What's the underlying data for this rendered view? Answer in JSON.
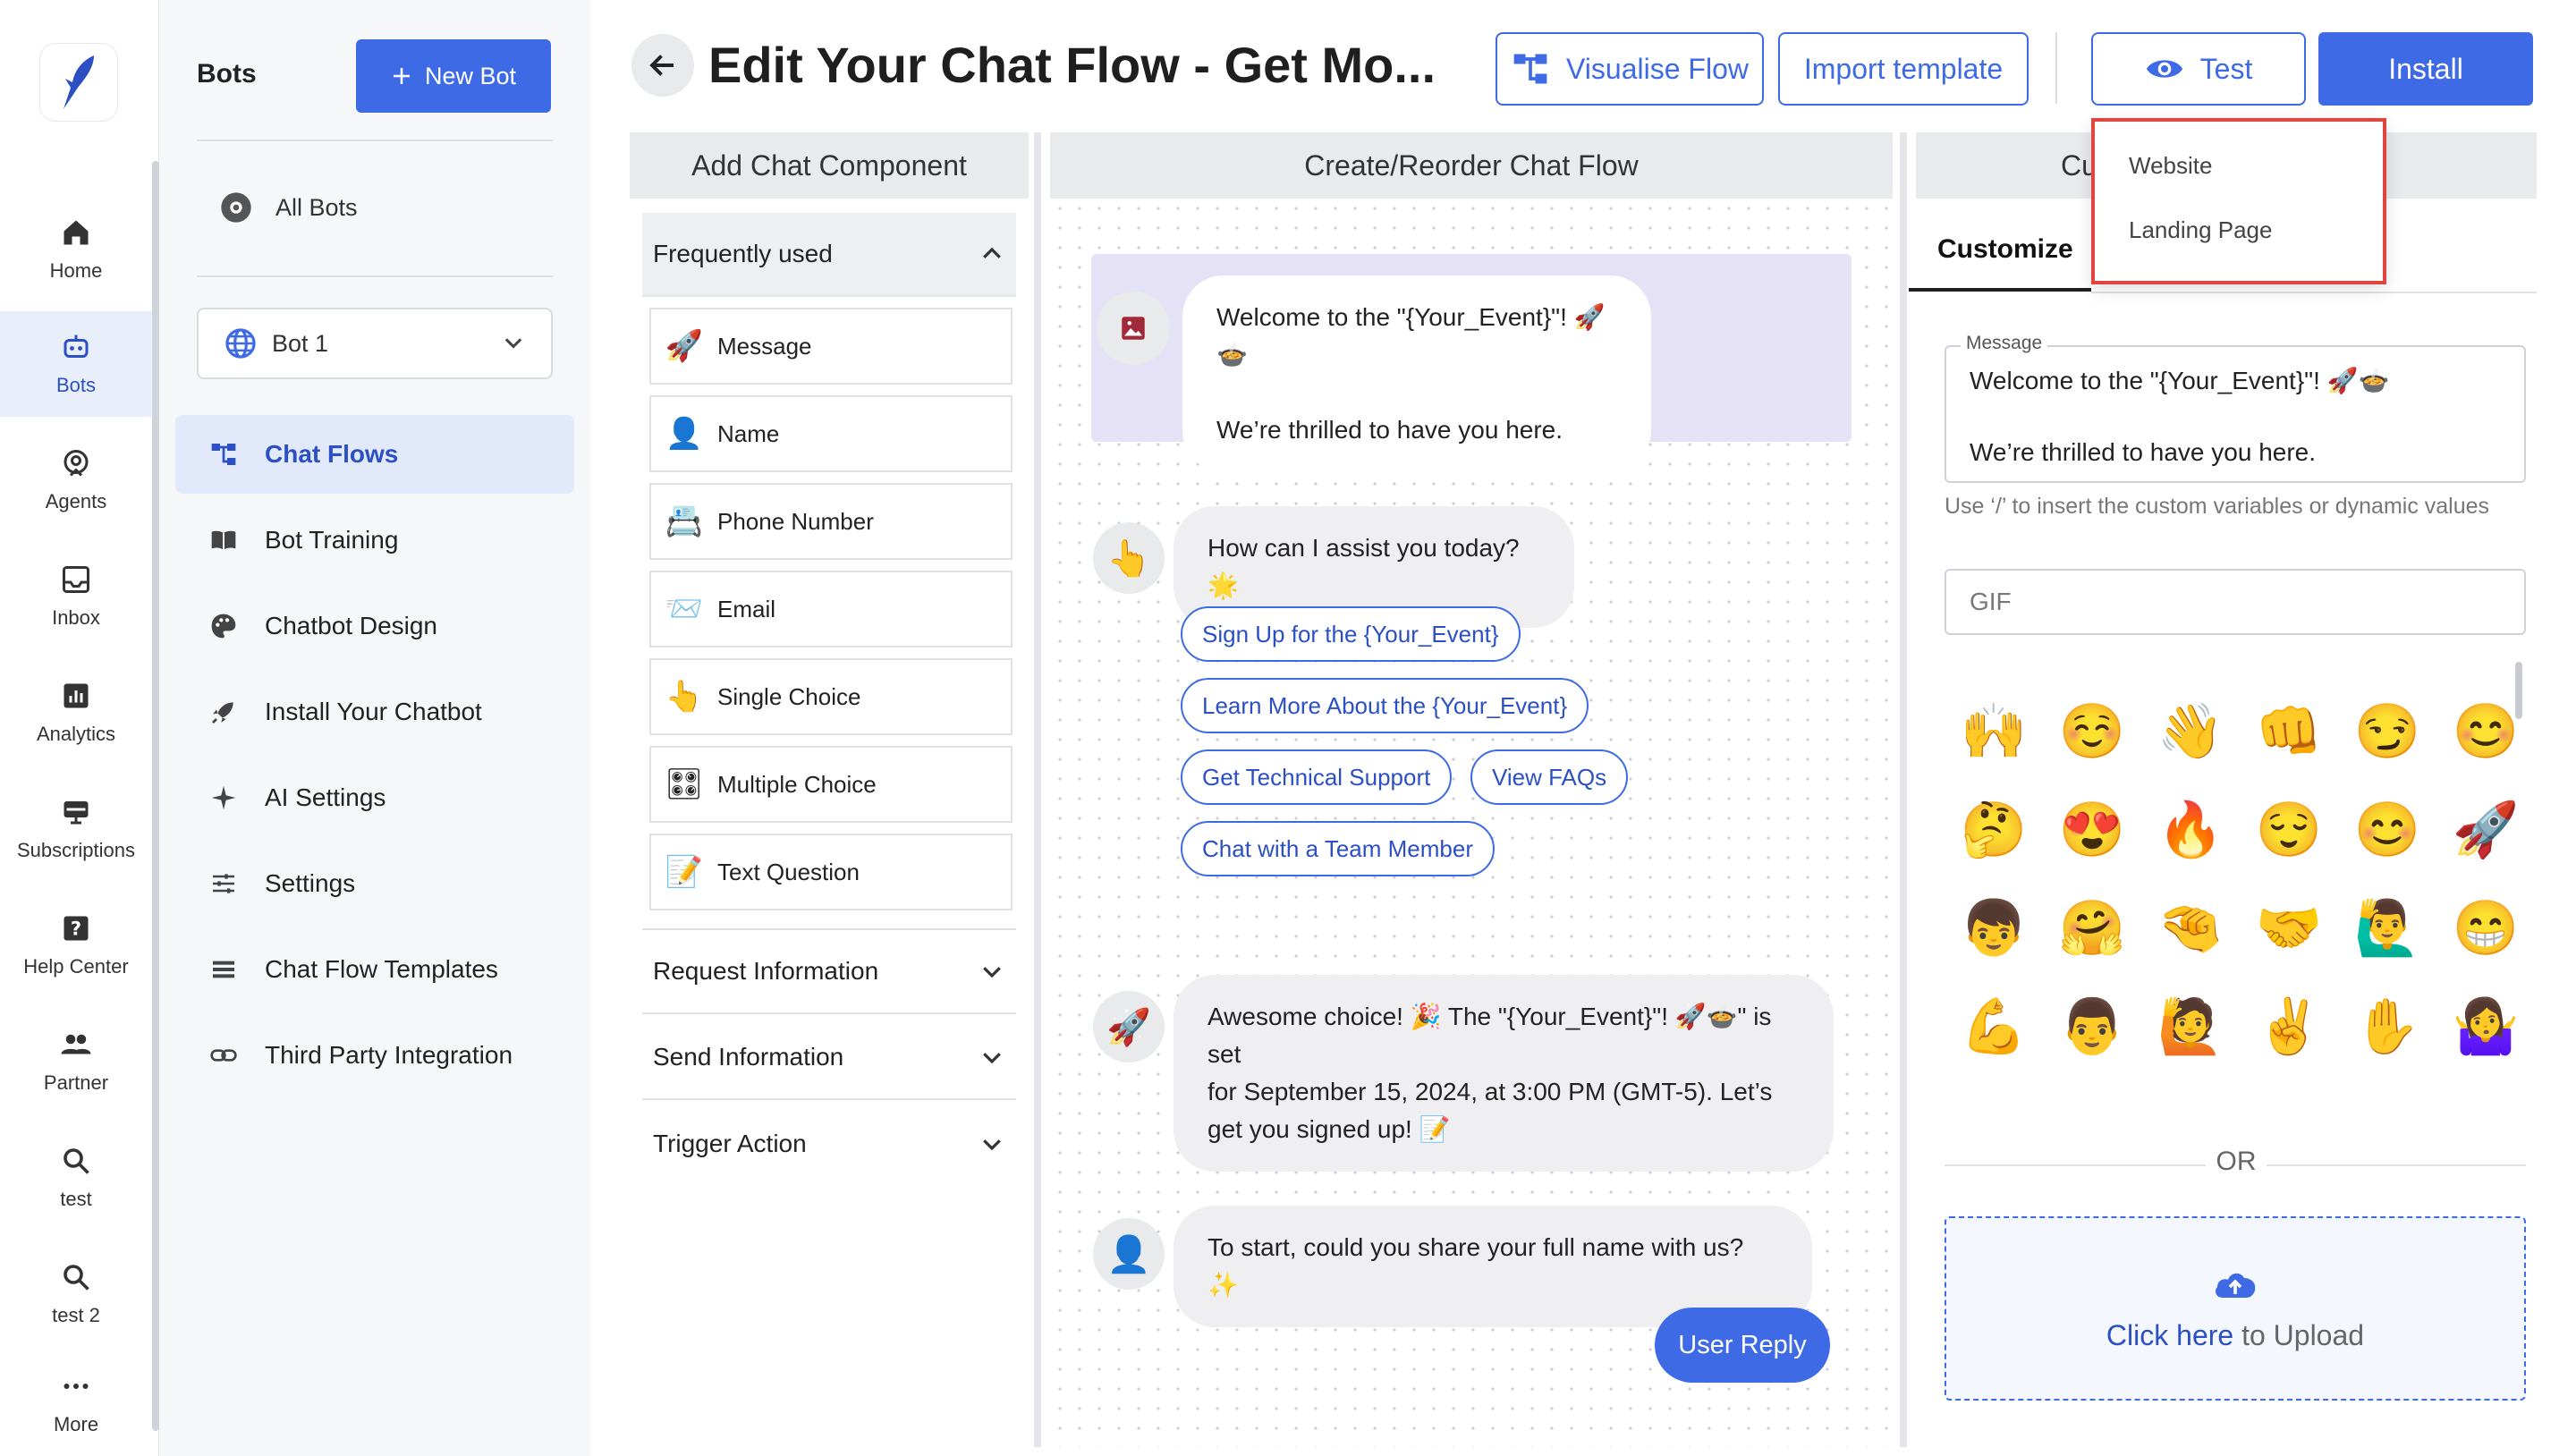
{
  "rail": {
    "items": [
      {
        "label": "Home",
        "icon": "home-icon"
      },
      {
        "label": "Bots",
        "icon": "bot-icon",
        "active": true
      },
      {
        "label": "Agents",
        "icon": "agents-icon"
      },
      {
        "label": "Inbox",
        "icon": "inbox-icon"
      },
      {
        "label": "Analytics",
        "icon": "analytics-icon"
      },
      {
        "label": "Subscriptions",
        "icon": "subscriptions-icon"
      },
      {
        "label": "Help Center",
        "icon": "help-icon"
      },
      {
        "label": "Partner",
        "icon": "partner-icon"
      },
      {
        "label": "test",
        "icon": "search-icon"
      },
      {
        "label": "test 2",
        "icon": "search-icon"
      },
      {
        "label": "More",
        "icon": "more-icon"
      }
    ]
  },
  "bots_panel": {
    "title": "Bots",
    "new_bot_label": "New Bot",
    "all_bots_label": "All Bots",
    "selected_bot": "Bot 1",
    "nav": [
      {
        "label": "Chat Flows",
        "icon": "chat-flows-icon",
        "active": true
      },
      {
        "label": "Bot Training",
        "icon": "book-icon"
      },
      {
        "label": "Chatbot Design",
        "icon": "palette-icon"
      },
      {
        "label": "Install Your Chatbot",
        "icon": "rocket-icon"
      },
      {
        "label": "AI Settings",
        "icon": "sparkle-icon"
      },
      {
        "label": "Settings",
        "icon": "sliders-icon"
      },
      {
        "label": "Chat Flow Templates",
        "icon": "templates-icon"
      },
      {
        "label": "Third Party Integration",
        "icon": "link-icon"
      }
    ]
  },
  "header": {
    "title": "Edit Your Chat Flow - Get Mo...",
    "visualise_label": "Visualise Flow",
    "import_label": "Import template",
    "test_label": "Test",
    "install_label": "Install"
  },
  "dropdown": {
    "items": [
      "Website",
      "Landing Page"
    ]
  },
  "columns": {
    "add_component": "Add Chat Component",
    "create_flow": "Create/Reorder Chat Flow",
    "customize_head": "Cu"
  },
  "palette": {
    "frequently_used": "Frequently used",
    "components": [
      {
        "label": "Message",
        "icon": "🚀"
      },
      {
        "label": "Name",
        "icon": "👤"
      },
      {
        "label": "Phone Number",
        "icon": "📇"
      },
      {
        "label": "Email",
        "icon": "📨"
      },
      {
        "label": "Single Choice",
        "icon": "👆"
      },
      {
        "label": "Multiple Choice",
        "icon": "🎛"
      },
      {
        "label": "Text Question",
        "icon": "📝"
      }
    ],
    "sections": [
      "Request Information",
      "Send Information",
      "Trigger Action"
    ]
  },
  "flow": {
    "welcome_line1": "Welcome to the \"{Your_Event}\"! 🚀🍲",
    "welcome_line2": "We’re thrilled to have you here.",
    "question": "How can I assist you today? 🌟",
    "choices": [
      "Sign Up for the {Your_Event}",
      "Learn More About the {Your_Event}",
      "Get Technical Support",
      "View FAQs",
      "Chat with a Team Member"
    ],
    "awesome_line1": "Awesome choice! 🎉 The \"{Your_Event}\"! 🚀🍲\" is set",
    "awesome_line2": "for September 15, 2024, at 3:00 PM (GMT-5). Let’s",
    "awesome_line3": "get you signed up! 📝",
    "name_question": "To start, could you share your full name with us? ✨",
    "user_reply": "User Reply"
  },
  "customize": {
    "tab_label": "Customize",
    "message_label": "Message",
    "message_line1": "Welcome to the \"{Your_Event}\"! 🚀🍲",
    "message_line2": "We’re thrilled to have you here.",
    "hint": "Use ‘/’ to insert the custom variables or dynamic values",
    "gif_placeholder": "GIF",
    "emojis": [
      "🙌",
      "☺️",
      "👋",
      "👊",
      "😏",
      "😊",
      "🤔",
      "😍",
      "🔥",
      "😌",
      "😊",
      "🚀",
      "👦",
      "🤗",
      "🤏",
      "🤝",
      "🙋‍♂️",
      "😁",
      "💪",
      "👨",
      "🙋",
      "✌️",
      "✋",
      "🤷‍♀️"
    ],
    "or_text": "OR",
    "upload_link": "Click here",
    "upload_rest": "to Upload"
  },
  "colors": {
    "accent": "#3f6ae6",
    "active_bg": "#e2e9fb",
    "welcome_card": "#e5e1f6",
    "highlight_border": "#e0463e"
  }
}
